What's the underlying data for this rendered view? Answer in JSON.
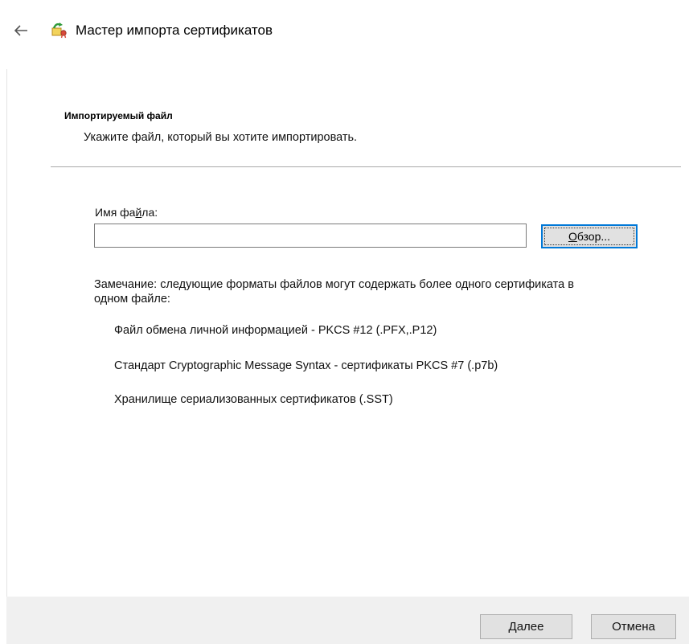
{
  "window": {
    "title": "Мастер импорта сертификатов"
  },
  "icons": {
    "back": "back-arrow-icon",
    "wizard": "certificate-wizard-icon"
  },
  "section": {
    "title": "Импортируемый файл",
    "subtitle": "Укажите файл, который вы хотите импортировать."
  },
  "form": {
    "label_prefix": "Имя фа",
    "label_access_key": "й",
    "label_suffix": "ла:",
    "file_value": "",
    "browse_access_key": "О",
    "browse_rest": "бзор..."
  },
  "note": {
    "text": "Замечание: следующие форматы файлов могут содержать более одного сертификата в одном файле:",
    "formats": [
      "Файл обмена личной информацией - PKCS #12 (.PFX,.P12)",
      "Стандарт Cryptographic Message Syntax - сертификаты PKCS #7 (.p7b)",
      "Хранилище сериализованных сертификатов (.SST)"
    ]
  },
  "footer": {
    "next_access_key": "Д",
    "next_rest": "алее",
    "cancel_label": "Отмена"
  },
  "colors": {
    "accent": "#0078d7",
    "button_face": "#e1e1e1",
    "footer_bg": "#f0f0f0"
  }
}
